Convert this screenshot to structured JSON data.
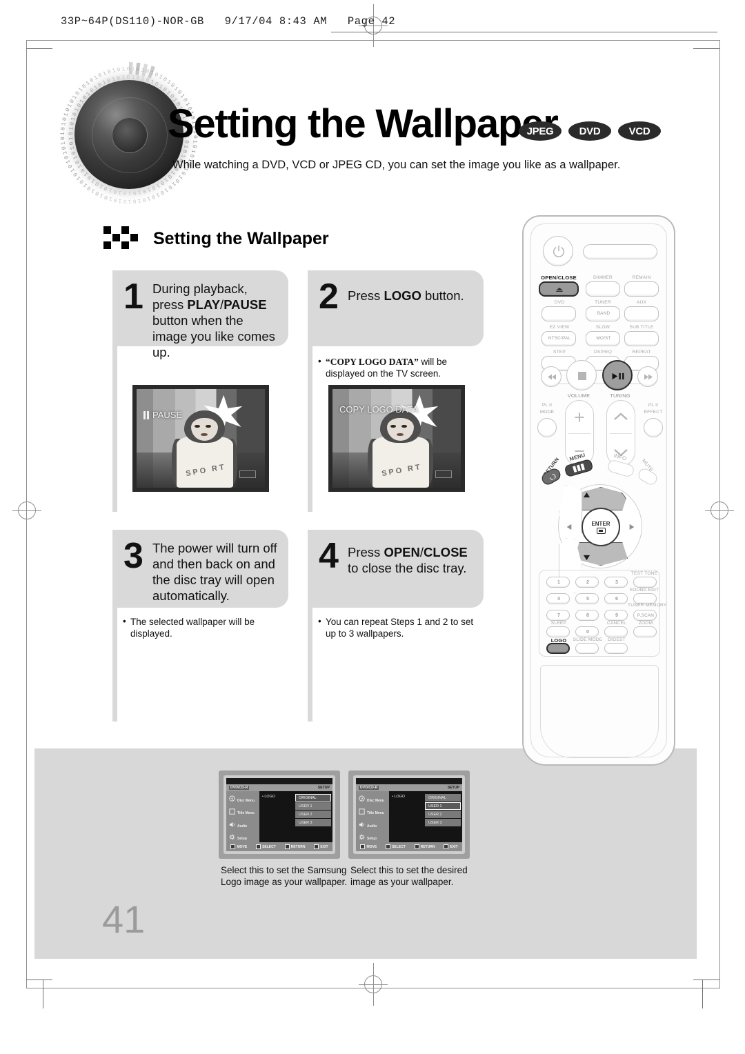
{
  "header": {
    "print_slug": "33P~64P(DS110)-NOR-GB   9/17/04 8:43 AM   Page 42"
  },
  "title": {
    "main": "Setting the Wallpaper",
    "badges": [
      "JPEG",
      "DVD",
      "VCD"
    ],
    "subtitle": "While watching a DVD, VCD or JPEG CD, you can set the image you like as a wallpaper."
  },
  "section": {
    "heading": "Setting the Wallpaper"
  },
  "steps": [
    {
      "number": "1",
      "text_parts": [
        {
          "t": "During playback, press ",
          "b": false
        },
        {
          "t": "PLAY",
          "b": true
        },
        {
          "t": "/",
          "b": false
        },
        {
          "t": "PAUSE",
          "b": true
        },
        {
          "t": " button when the image you like comes up.",
          "b": false
        }
      ],
      "note": "",
      "tv": {
        "osd_label": "PAUSE",
        "osd_icon": "pause-icon"
      }
    },
    {
      "number": "2",
      "text_parts": [
        {
          "t": "Press ",
          "b": false
        },
        {
          "t": "LOGO",
          "b": true
        },
        {
          "t": " button.",
          "b": false
        }
      ],
      "note": "“COPY LOGO DATA” will be displayed on the TV screen.",
      "note_bold_prefix": "“COPY LOGO DATA”",
      "tv": {
        "osd_label": "COPY LOGO DATA",
        "osd_icon": "text-overlay"
      }
    },
    {
      "number": "3",
      "text_parts": [
        {
          "t": "The power will turn off and then back on and the disc tray will open automatically.",
          "b": false
        }
      ],
      "note": "The selected wallpaper will be displayed."
    },
    {
      "number": "4",
      "text_parts": [
        {
          "t": "Press ",
          "b": false
        },
        {
          "t": "OPEN",
          "b": true
        },
        {
          "t": "/",
          "b": false
        },
        {
          "t": "CLOSE",
          "b": true
        },
        {
          "t": " to close the disc tray.",
          "b": false
        }
      ],
      "note": "You can repeat Steps 1 and 2 to set up to 3 wallpapers."
    }
  ],
  "remote": {
    "power_icon": "power-icon",
    "top_labels": [
      "OPEN/CLOSE",
      "DIMMER",
      "REMAIN",
      "DVD",
      "TUNER",
      "AUX",
      "EZ VIEW",
      "SLOW",
      "SUB TITLE",
      "STEP",
      "DSP/EQ",
      "REPEAT"
    ],
    "inner_labels": [
      "BAND",
      "NTSC/PAL",
      "MO/ST"
    ],
    "transport": {
      "prev": "prev-icon",
      "stop": "stop-icon",
      "play_pause": "play-pause-icon",
      "next": "next-icon"
    },
    "volume_label": "VOLUME",
    "tuning_label": "TUNING",
    "plii_mode": [
      "PL II",
      "MODE"
    ],
    "plii_effect": [
      "PL II",
      "EFFECT"
    ],
    "nav": {
      "menu": "MENU",
      "return": "RETURN",
      "info": "INFO",
      "mute": "MUTE",
      "enter": "ENTER"
    },
    "keypad": {
      "digits": [
        "1",
        "2",
        "3",
        "4",
        "5",
        "6",
        "7",
        "8",
        "9",
        "0"
      ],
      "right_labels": [
        "TEST TONE",
        "SOUND EDIT",
        "TUNER MEMORY",
        "ZOOM"
      ],
      "pscan": "P.SCAN",
      "sleep": "SLEEP",
      "cancel": "CANCEL",
      "logo": "LOGO",
      "slide_mode": "SLIDE MODE",
      "digest": "DIGEST"
    },
    "highlighted_buttons": [
      "OPEN/CLOSE",
      "play-pause-icon",
      "LOGO"
    ]
  },
  "osd_screens": [
    {
      "topbar_left": "DVD/CD-R",
      "topbar_right": "SETUP",
      "side_items": [
        "Disc Menu",
        "Title Menu",
        "Audio",
        "Setup"
      ],
      "field_label": "LOGO",
      "options": [
        "ORIGINAL",
        "USER 1",
        "USER 2",
        "USER 3"
      ],
      "selected": "ORIGINAL",
      "bottom_bar": [
        "MOVE",
        "SELECT",
        "RETURN",
        "EXIT"
      ],
      "caption": "Select this to set the Samsung Logo image as your wallpaper."
    },
    {
      "topbar_left": "DVD/CD-R",
      "topbar_right": "SETUP",
      "side_items": [
        "Disc Menu",
        "Title Menu",
        "Audio",
        "Setup"
      ],
      "field_label": "LOGO",
      "options": [
        "ORIGINAL",
        "USER 1",
        "USER 2",
        "USER 3"
      ],
      "selected": "USER 1",
      "bottom_bar": [
        "MOVE",
        "SELECT",
        "RETURN",
        "EXIT"
      ],
      "caption": "Select this to set the desired image as your wallpaper."
    }
  ],
  "page_number": "41",
  "colors": {
    "step_box": "#d9d9d9",
    "bottom_panel": "#d8d8d8",
    "badge": "#2b2b2b",
    "page_number": "#9b9b9b"
  }
}
